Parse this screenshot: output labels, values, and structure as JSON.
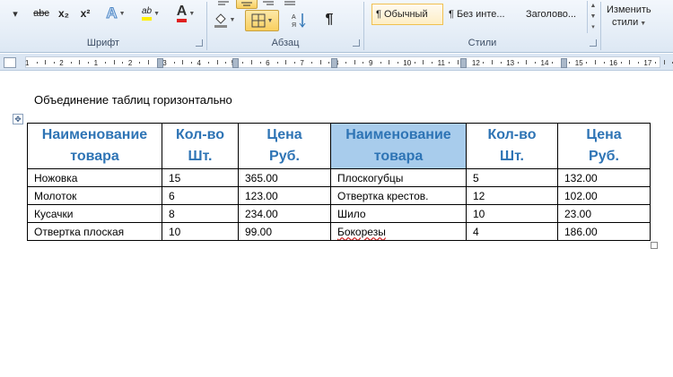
{
  "ribbon": {
    "font_group": {
      "label": "Шрифт",
      "buttons": [
        "abc",
        "x₂",
        "x²",
        "A",
        "ab",
        "A"
      ]
    },
    "paragraph_group": {
      "label": "Абзац",
      "pilcrow": "¶"
    },
    "styles_group": {
      "label": "Стили",
      "styles": [
        "¶ Обычный",
        "¶ Без инте...",
        "Заголово..."
      ],
      "change_styles": [
        "Изменить",
        "стили"
      ]
    },
    "accent_color": "#2e74b5"
  },
  "ruler": {
    "ticks": [
      "1",
      "2",
      "1",
      "2",
      "3",
      "4",
      "5",
      "6",
      "7",
      "8",
      "9",
      "10",
      "11",
      "12",
      "13",
      "14",
      "15",
      "16",
      "17"
    ]
  },
  "document": {
    "heading": "Объединение таблиц горизонтально",
    "table": {
      "headers": [
        [
          "Наименование",
          "товара"
        ],
        [
          "Кол-во",
          "Шт."
        ],
        [
          "Цена",
          "Руб."
        ],
        [
          "Наименование",
          "товара"
        ],
        [
          "Кол-во",
          "Шт."
        ],
        [
          "Цена",
          "Руб."
        ]
      ],
      "rows": [
        [
          "Ножовка",
          "15",
          "365.00",
          "Плоскогубцы",
          "5",
          "132.00"
        ],
        [
          "Молоток",
          "6",
          "123.00",
          "Отвертка крестов.",
          "12",
          "102.00"
        ],
        [
          "Кусачки",
          "8",
          "234.00",
          "Шило",
          "10",
          "23.00"
        ],
        [
          "Отвертка плоская",
          "10",
          "99.00",
          "Бокорезы",
          "4",
          "186.00"
        ]
      ]
    }
  }
}
